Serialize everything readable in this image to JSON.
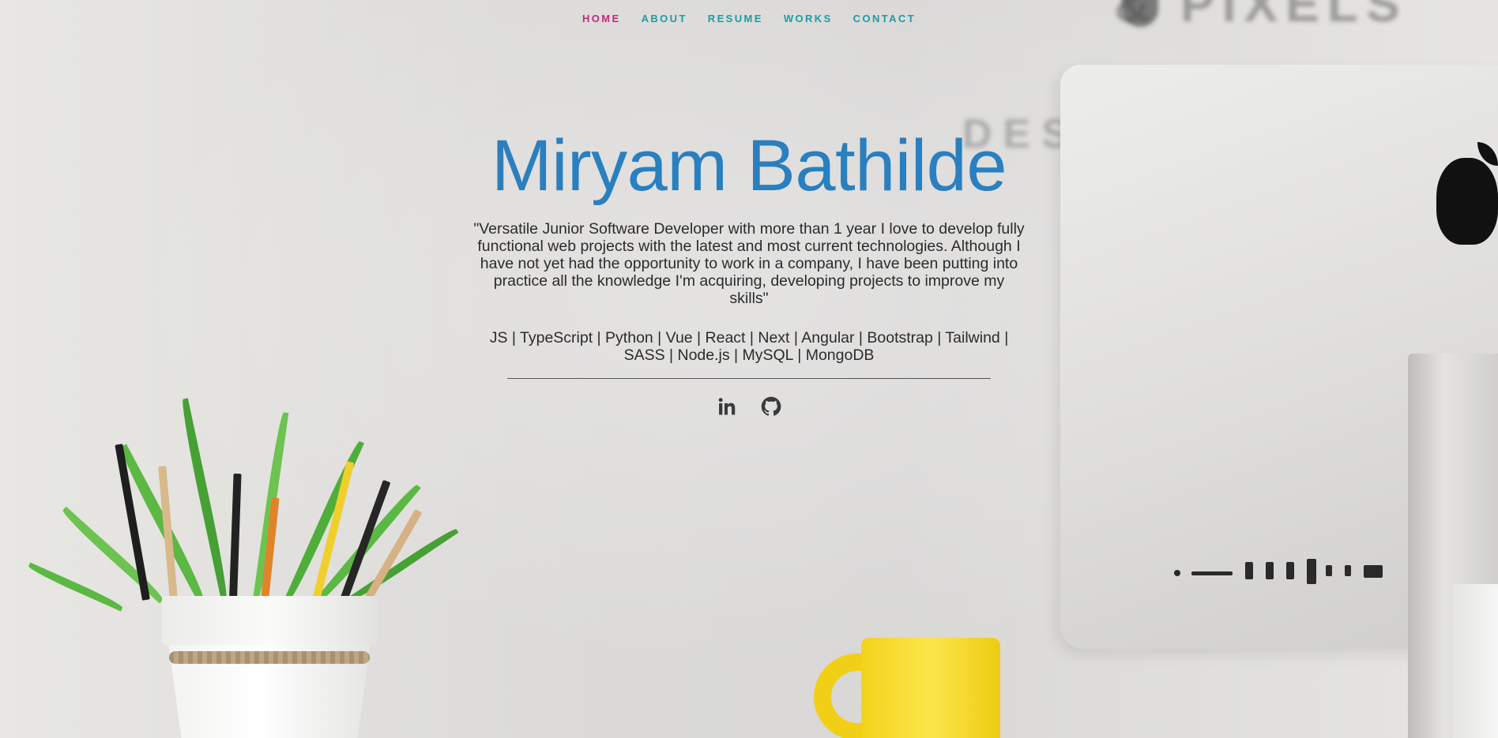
{
  "nav": {
    "items": [
      {
        "label": "HOME",
        "active": true
      },
      {
        "label": "ABOUT",
        "active": false
      },
      {
        "label": "RESUME",
        "active": false
      },
      {
        "label": "WORKS",
        "active": false
      },
      {
        "label": "CONTACT",
        "active": false
      }
    ],
    "link_color": "#1b9ca3",
    "active_color": "#c0297a"
  },
  "hero": {
    "name": "Miryam Bathilde",
    "name_color": "#2a7fbf",
    "bio": "\"Versatile Junior Software Developer with more than 1 year I love to develop fully functional web projects with the latest and most current technologies. Although I have not yet had the opportunity to work in a company, I have been putting into practice all the knowledge I'm acquiring, developing projects to improve my skills\"",
    "skills": "JS | TypeScript | Python | Vue | React | Next | Angular | Bootstrap | Tailwind | SASS | Node.js | MySQL | MongoDB"
  },
  "social": {
    "icons": [
      "linkedin-icon",
      "github-icon"
    ]
  }
}
